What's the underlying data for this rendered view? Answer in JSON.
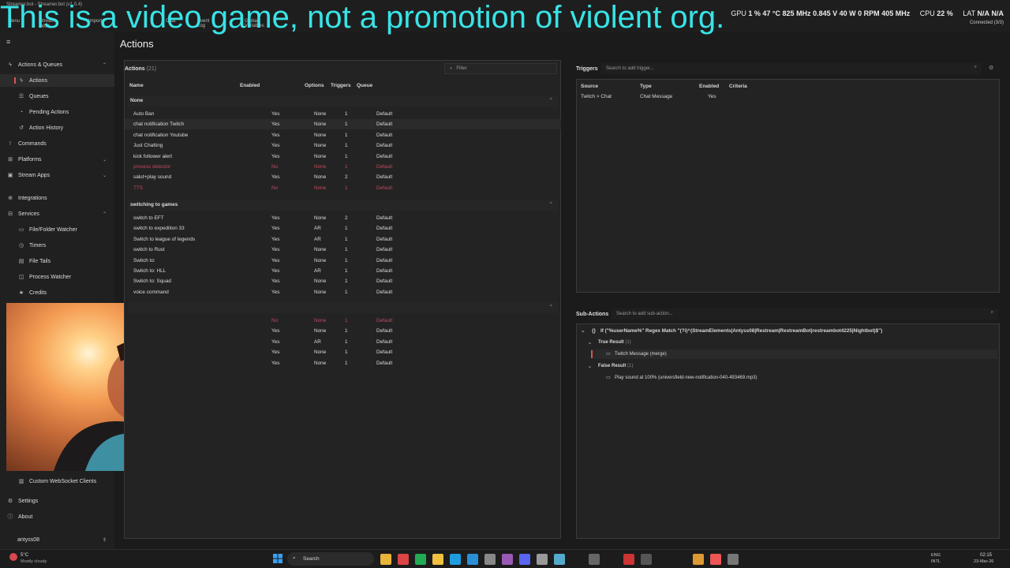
{
  "overlay": {
    "text": "This is a video game, not a promotion of violent org."
  },
  "window": {
    "title": "Streamer.bot - Streamer.bot (v1.0.4)"
  },
  "menu": [
    "Menu",
    "Stream Apps",
    "Import",
    "Chat",
    "Event Log",
    "Global Variables"
  ],
  "hw": {
    "gpu_label": "GPU",
    "gpu_pct": "1 %",
    "gpu_temp": "47 °C",
    "gpu_clock": "825 MHz",
    "gpu_volt": "0.845 V",
    "gpu_power": "40 W",
    "gpu_fan": "0 RPM",
    "gpu_mem": "405 MHz",
    "cpu_label": "CPU",
    "cpu_pct": "22 %",
    "lat_label": "LAT",
    "lat1": "N/A",
    "lat2": "N/A",
    "connected": "Connected (3/3)"
  },
  "sidebar": {
    "items": [
      {
        "label": "Actions & Queues",
        "icon": "lightning-icon"
      },
      {
        "label": "Actions",
        "icon": "lightning-icon"
      },
      {
        "label": "Queues",
        "icon": "queue-icon"
      },
      {
        "label": "Pending Actions",
        "icon": "clock-icon"
      },
      {
        "label": "Action History",
        "icon": "history-icon"
      },
      {
        "label": "Commands",
        "icon": "command-icon"
      },
      {
        "label": "Platforms",
        "icon": "platform-icon"
      },
      {
        "label": "Stream Apps",
        "icon": "apps-icon"
      },
      {
        "label": "Integrations",
        "icon": "integration-icon"
      },
      {
        "label": "Services",
        "icon": "services-icon"
      },
      {
        "label": "File/Folder Watcher",
        "icon": "folder-icon"
      },
      {
        "label": "Timers",
        "icon": "timer-icon"
      },
      {
        "label": "File Tails",
        "icon": "file-icon"
      },
      {
        "label": "Process Watcher",
        "icon": "process-icon"
      },
      {
        "label": "Credits",
        "icon": "credits-icon"
      },
      {
        "label": "Custom WebSocket Clients",
        "icon": "websocket-icon"
      },
      {
        "label": "Settings",
        "icon": "gear-icon"
      },
      {
        "label": "About",
        "icon": "info-icon"
      }
    ],
    "user": "antyss08"
  },
  "main": {
    "title": "Actions",
    "actions": {
      "label": "Actions",
      "count": "(21)",
      "filter_placeholder": "Filter",
      "columns": [
        "Name",
        "Enabled",
        "Options",
        "Triggers",
        "Queue"
      ]
    },
    "groups": [
      {
        "name": "None",
        "rows": [
          [
            "Auto Ban",
            "Yes",
            "None",
            "1",
            "Default"
          ],
          [
            "chat notification Twitch",
            "Yes",
            "None",
            "1",
            "Default"
          ],
          [
            "chat notification Youtube",
            "Yes",
            "None",
            "1",
            "Default"
          ],
          [
            "Just Chatting",
            "Yes",
            "None",
            "1",
            "Default"
          ],
          [
            "kick follower alert",
            "Yes",
            "None",
            "1",
            "Default"
          ],
          [
            "process detector",
            "No",
            "None",
            "1",
            "Default"
          ],
          [
            "salut+play sound",
            "Yes",
            "None",
            "2",
            "Default"
          ],
          [
            "TTS",
            "No",
            "None",
            "1",
            "Default"
          ]
        ]
      },
      {
        "name": "switching to games",
        "rows": [
          [
            "switch to EFT",
            "Yes",
            "None",
            "2",
            "Default"
          ],
          [
            "switch to expedition 33",
            "Yes",
            "AR",
            "1",
            "Default"
          ],
          [
            "Switch to league of legends",
            "Yes",
            "AR",
            "1",
            "Default"
          ],
          [
            "switch to Rust",
            "Yes",
            "None",
            "1",
            "Default"
          ],
          [
            "Switch to:",
            "Yes",
            "None",
            "1",
            "Default"
          ],
          [
            "Switch to: HLL",
            "Yes",
            "AR",
            "1",
            "Default"
          ],
          [
            "Switch to: Squad",
            "Yes",
            "None",
            "1",
            "Default"
          ],
          [
            "voice command",
            "Yes",
            "None",
            "1",
            "Default"
          ]
        ]
      },
      {
        "name": "",
        "rows": [
          [
            "",
            "No",
            "None",
            "1",
            "Default"
          ],
          [
            "",
            "Yes",
            "None",
            "1",
            "Default"
          ],
          [
            "",
            "Yes",
            "AR",
            "1",
            "Default"
          ],
          [
            "",
            "Yes",
            "None",
            "1",
            "Default"
          ],
          [
            "",
            "Yes",
            "None",
            "1",
            "Default"
          ]
        ]
      }
    ],
    "triggers": {
      "label": "Triggers",
      "search_placeholder": "Search to add trigger...",
      "columns": [
        "Source",
        "Type",
        "Enabled",
        "Criteria"
      ],
      "rows": [
        [
          "Twitch > Chat",
          "Chat Message",
          "Yes",
          ""
        ]
      ]
    },
    "subactions": {
      "label": "Sub-Actions",
      "search_placeholder": "Search to add sub-action...",
      "if_line": "If (\"%userName%\" Regex Match \"(?i)^(StreamElements|Antyss08|Restream|RestreamBot|restreambot4225|Nightbot)$\")",
      "true_label": "True Result",
      "true_count": "(1)",
      "true_item": "Twitch Message (merge)",
      "false_label": "False Result",
      "false_count": "(1)",
      "false_item": "Play sound at 100% (universfield-new-notification-040-493469.mp3)"
    }
  },
  "taskbar": {
    "weather_temp": "5°C",
    "weather_desc": "Mostly cloudy",
    "search": "Search",
    "lang1": "ENG",
    "lang2": "INTL",
    "time": "02:15",
    "date": "23-Mar-26"
  },
  "colors": {
    "accent_red": "#d9534f",
    "disabled_text": "#c0495f",
    "overlay": "#38e3e6"
  }
}
